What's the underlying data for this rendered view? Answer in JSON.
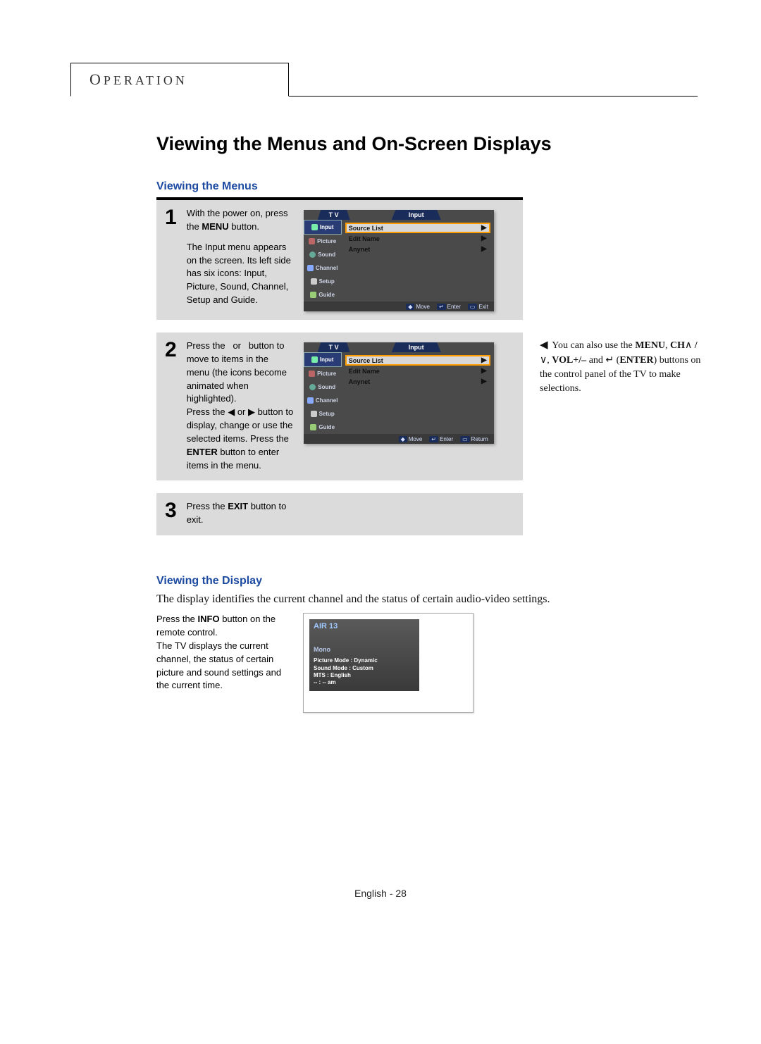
{
  "header": {
    "tab": "OPERATION"
  },
  "page_title": "Viewing the Menus and On-Screen Displays",
  "section1": {
    "title": "Viewing the Menus",
    "steps": [
      {
        "num": "1",
        "text_pre": "With the power on, press the ",
        "text_bold": "MENU",
        "text_post": " button.",
        "para2": "The Input menu appears on the screen. Its left side has six icons: Input, Picture, Sound, Channel, Setup and Guide.",
        "osd_footer3": "Exit"
      },
      {
        "num": "2",
        "text1_a": "Press the ",
        "text1_b": " or ",
        "text1_c": " button to move to items in the menu (the icons become animated when highlighted).",
        "text2_a": "Press the ",
        "text2_b": " or ",
        "text2_c": " button to display, change or use the selected items. Press the ",
        "text2_bold": "ENTER",
        "text2_d": " button to enter items in the menu.",
        "osd_footer3": "Return"
      },
      {
        "num": "3",
        "text_pre": "Press the ",
        "text_bold": "EXIT",
        "text_post": " button to exit."
      }
    ],
    "osd": {
      "banner_left": "T V",
      "banner_right": "Input",
      "side": [
        "Input",
        "Picture",
        "Sound",
        "Channel",
        "Setup",
        "Guide"
      ],
      "items": [
        "Source List",
        "Edit Name",
        "Anynet"
      ],
      "footer1": "Move",
      "footer2": "Enter"
    },
    "sidenote_a": "You can also use the ",
    "sidenote_b": "MENU",
    "sidenote_c": ", ",
    "sidenote_d": "CH",
    "sidenote_e": " / ",
    "sidenote_f": ", ",
    "sidenote_g": "VOL+/–",
    "sidenote_h": " and ",
    "sidenote_i": "ENTER",
    "sidenote_j": ") buttons on the control panel of the TV to make selections."
  },
  "section2": {
    "title": "Viewing the Display",
    "body": "The display identifies the current channel and the status of certain audio-video settings.",
    "info_text_a": "Press the ",
    "info_text_bold": "INFO",
    "info_text_b": " button on the remote control.",
    "info_text_c": "The TV displays the current channel, the status of certain picture and sound settings and the current time.",
    "info_osd": {
      "channel": "AIR 13",
      "mono": "Mono",
      "l1": "Picture Mode : Dynamic",
      "l2": "Sound Mode : Custom",
      "l3": "MTS : English",
      "l4": "-- : -- am"
    }
  },
  "footer": {
    "lang": "English",
    "page": "28"
  }
}
